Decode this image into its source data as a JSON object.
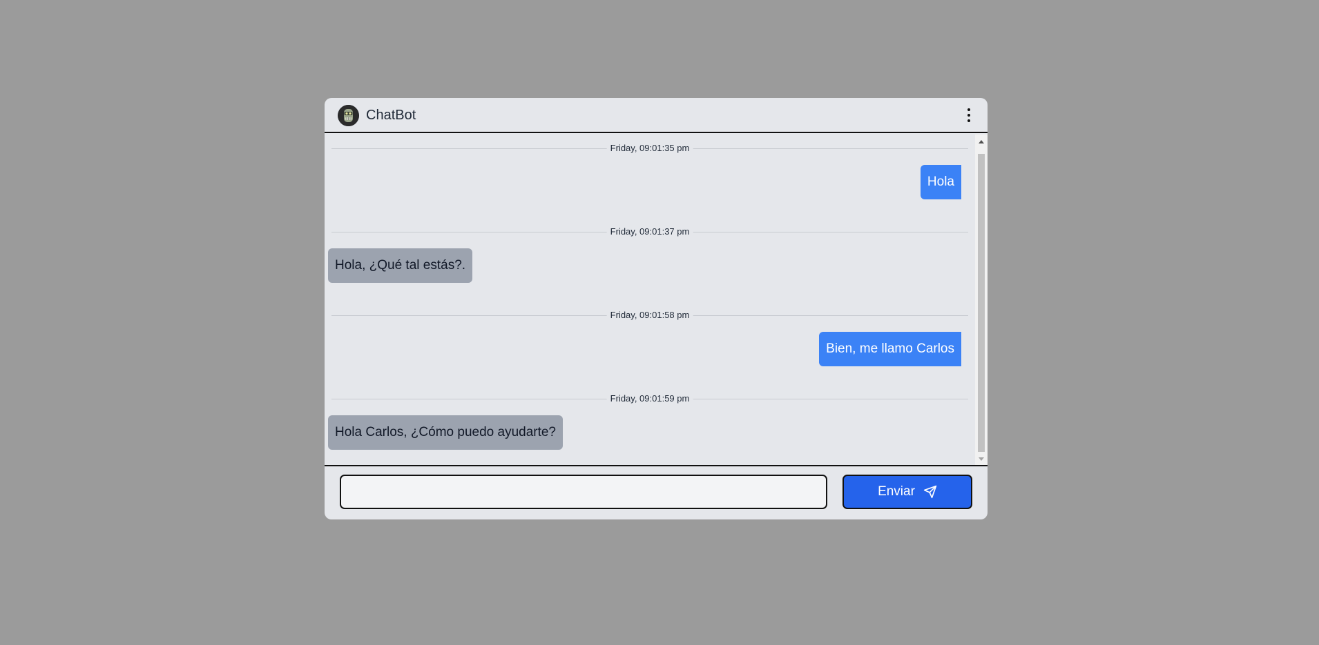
{
  "header": {
    "title": "ChatBot",
    "avatar_icon": "robot-avatar-icon",
    "menu_icon": "vertical-dots-icon"
  },
  "messages": [
    {
      "type": "timestamp",
      "text": "Friday, 09:01:35 pm"
    },
    {
      "type": "user",
      "text": "Hola"
    },
    {
      "type": "timestamp",
      "text": "Friday, 09:01:37 pm"
    },
    {
      "type": "bot",
      "text": "Hola, ¿Qué tal estás?."
    },
    {
      "type": "timestamp",
      "text": "Friday, 09:01:58 pm"
    },
    {
      "type": "user",
      "text": "Bien, me llamo Carlos"
    },
    {
      "type": "timestamp",
      "text": "Friday, 09:01:59 pm"
    },
    {
      "type": "bot",
      "text": "Hola Carlos, ¿Cómo puedo ayudarte?"
    }
  ],
  "composer": {
    "input_value": "",
    "input_placeholder": "",
    "send_label": "Enviar",
    "send_icon": "paper-plane-icon"
  },
  "colors": {
    "background": "#9b9b9b",
    "panel": "#e5e7eb",
    "user_bubble": "#3b82f6",
    "bot_bubble": "#9ca3af",
    "send_button": "#2563eb"
  }
}
